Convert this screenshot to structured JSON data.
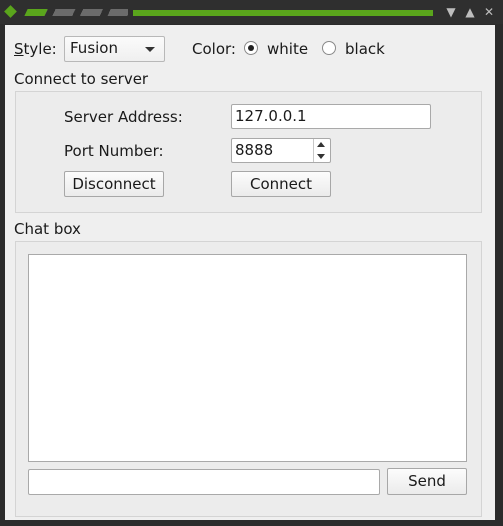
{
  "titlebar": {
    "buttons": [
      "▼",
      "▲",
      "✕"
    ],
    "accent_color": "#5aa51c"
  },
  "style": {
    "label": "Style:",
    "mnemonic": "S",
    "rest": "tyle:",
    "value": "Fusion"
  },
  "color": {
    "label": "Color:",
    "options": [
      "white",
      "black"
    ],
    "selected": "white"
  },
  "server_group": {
    "title": "Connect to server",
    "address_label": "Server Address:",
    "address_value": "127.0.0.1",
    "port_label": "Port Number:",
    "port_value": "8888",
    "disconnect_label": "Disconnect",
    "connect_label": "Connect"
  },
  "chat_group": {
    "title": "Chat box",
    "message_value": "",
    "send_label": "Send"
  }
}
